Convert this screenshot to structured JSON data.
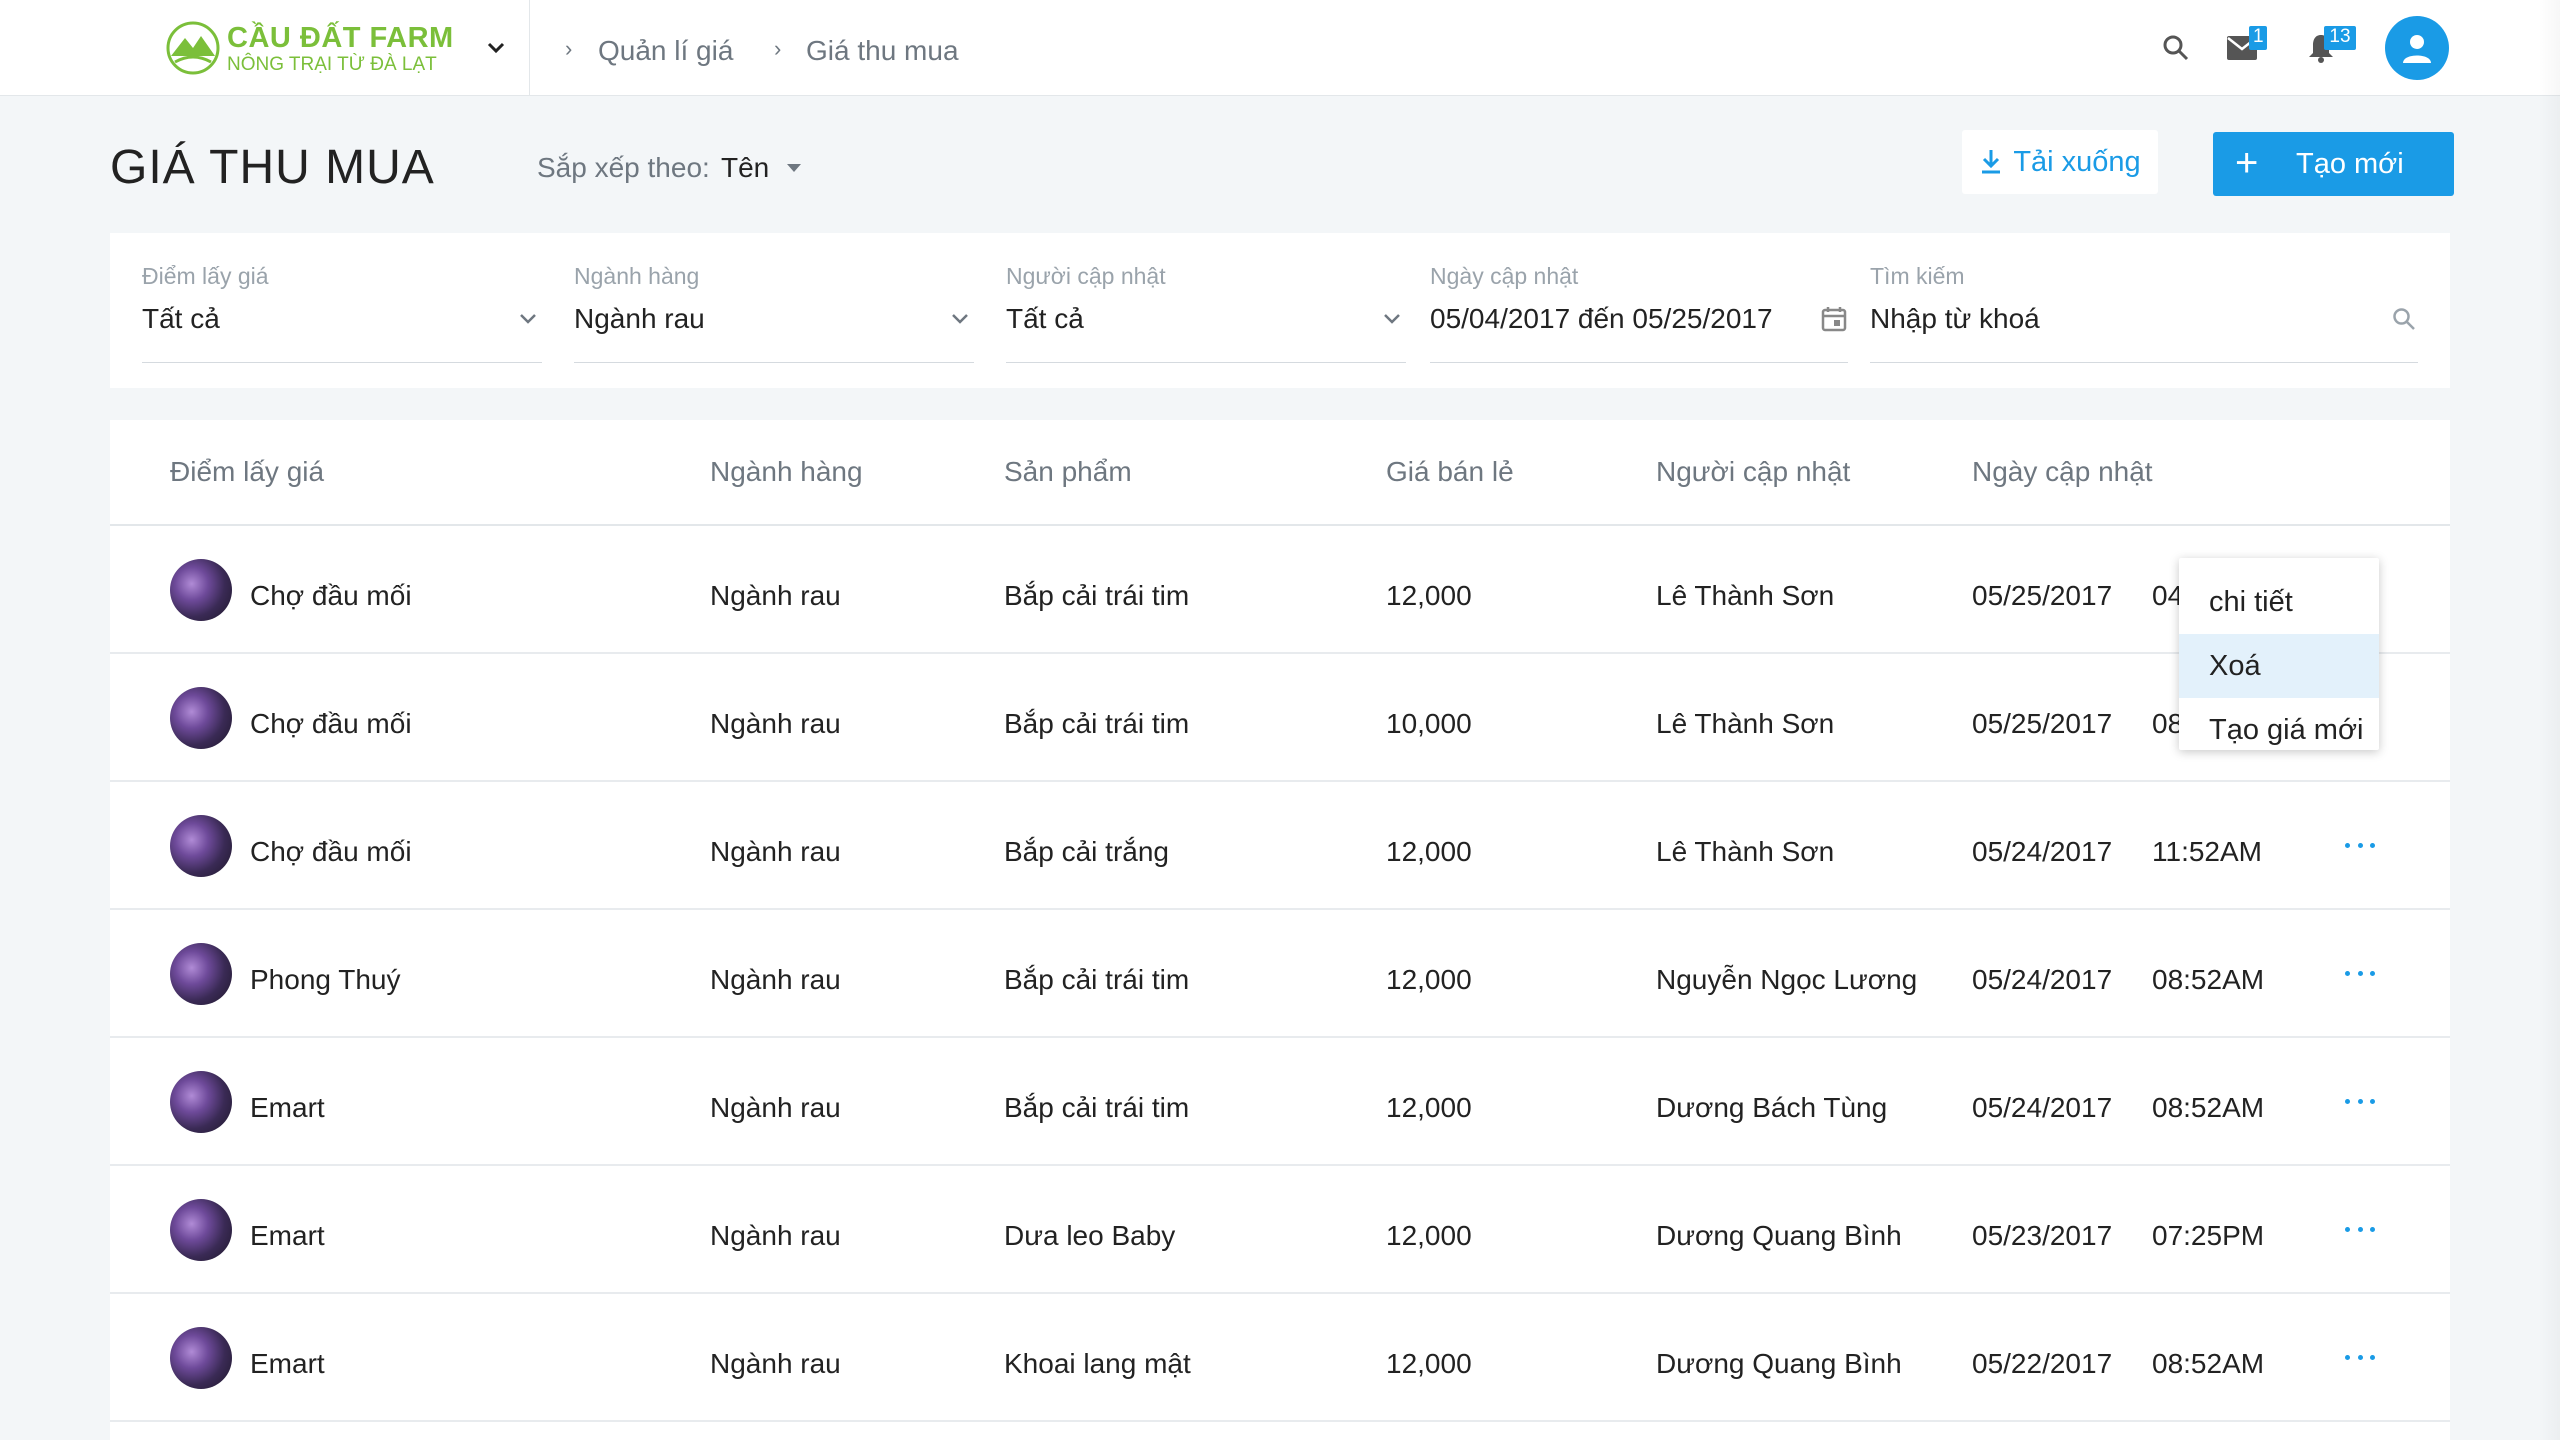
{
  "brand": {
    "title": "CẦU ĐẤT FARM",
    "subtitle": "NÔNG TRẠI TỪ ĐÀ LẠT",
    "color": "#7bbf3a"
  },
  "breadcrumb": [
    "Quản lí giá",
    "Giá thu mua"
  ],
  "topbar": {
    "mail_badge": "1",
    "notification_badge": "13",
    "accent": "#1a9be6"
  },
  "page": {
    "title": "GIÁ THU MUA",
    "sort_label": "Sắp xếp theo:",
    "sort_value": "Tên",
    "download_label": "Tải xuống",
    "create_label": "Tạo mới"
  },
  "filters": {
    "location": {
      "label": "Điểm lấy giá",
      "value": "Tất cả"
    },
    "category": {
      "label": "Ngành hàng",
      "value": "Ngành rau"
    },
    "updater": {
      "label": "Người cập nhật",
      "value": "Tất cả"
    },
    "date": {
      "label": "Ngày cập nhật",
      "value": "05/04/2017 đến 05/25/2017"
    },
    "search": {
      "label": "Tìm kiếm",
      "placeholder": "Nhập từ khoá"
    }
  },
  "table": {
    "columns": [
      "Điểm lấy giá",
      "Ngành hàng",
      "Sản phẩm",
      "Giá bán lẻ",
      "Người cập nhật",
      "Ngày cập nhật"
    ],
    "rows": [
      {
        "location": "Chợ đầu mối",
        "category": "Ngành rau",
        "product": "Bắp cải trái tim",
        "price": "12,000",
        "updater": "Lê Thành Sơn",
        "date": "05/25/2017",
        "time": "04"
      },
      {
        "location": "Chợ đầu mối",
        "category": "Ngành rau",
        "product": "Bắp cải trái tim",
        "price": "10,000",
        "updater": "Lê Thành Sơn",
        "date": "05/25/2017",
        "time": "08"
      },
      {
        "location": "Chợ đầu mối",
        "category": "Ngành rau",
        "product": "Bắp cải trắng",
        "price": "12,000",
        "updater": "Lê Thành Sơn",
        "date": "05/24/2017",
        "time": "11:52AM"
      },
      {
        "location": "Phong Thuý",
        "category": "Ngành rau",
        "product": "Bắp cải trái tim",
        "price": "12,000",
        "updater": "Nguyễn Ngọc Lương",
        "date": "05/24/2017",
        "time": "08:52AM"
      },
      {
        "location": "Emart",
        "category": "Ngành rau",
        "product": "Bắp cải trái tim",
        "price": "12,000",
        "updater": "Dương Bách Tùng",
        "date": "05/24/2017",
        "time": "08:52AM"
      },
      {
        "location": "Emart",
        "category": "Ngành rau",
        "product": "Dưa leo Baby",
        "price": "12,000",
        "updater": "Dương Quang Bình",
        "date": "05/23/2017",
        "time": "07:25PM"
      },
      {
        "location": "Emart",
        "category": "Ngành rau",
        "product": "Khoai lang mật",
        "price": "12,000",
        "updater": "Dương Quang Bình",
        "date": "05/22/2017",
        "time": "08:52AM"
      }
    ]
  },
  "context_menu": {
    "items": [
      "chi tiết",
      "Xoá",
      "Tạo giá mới"
    ],
    "highlighted": "Xoá"
  }
}
